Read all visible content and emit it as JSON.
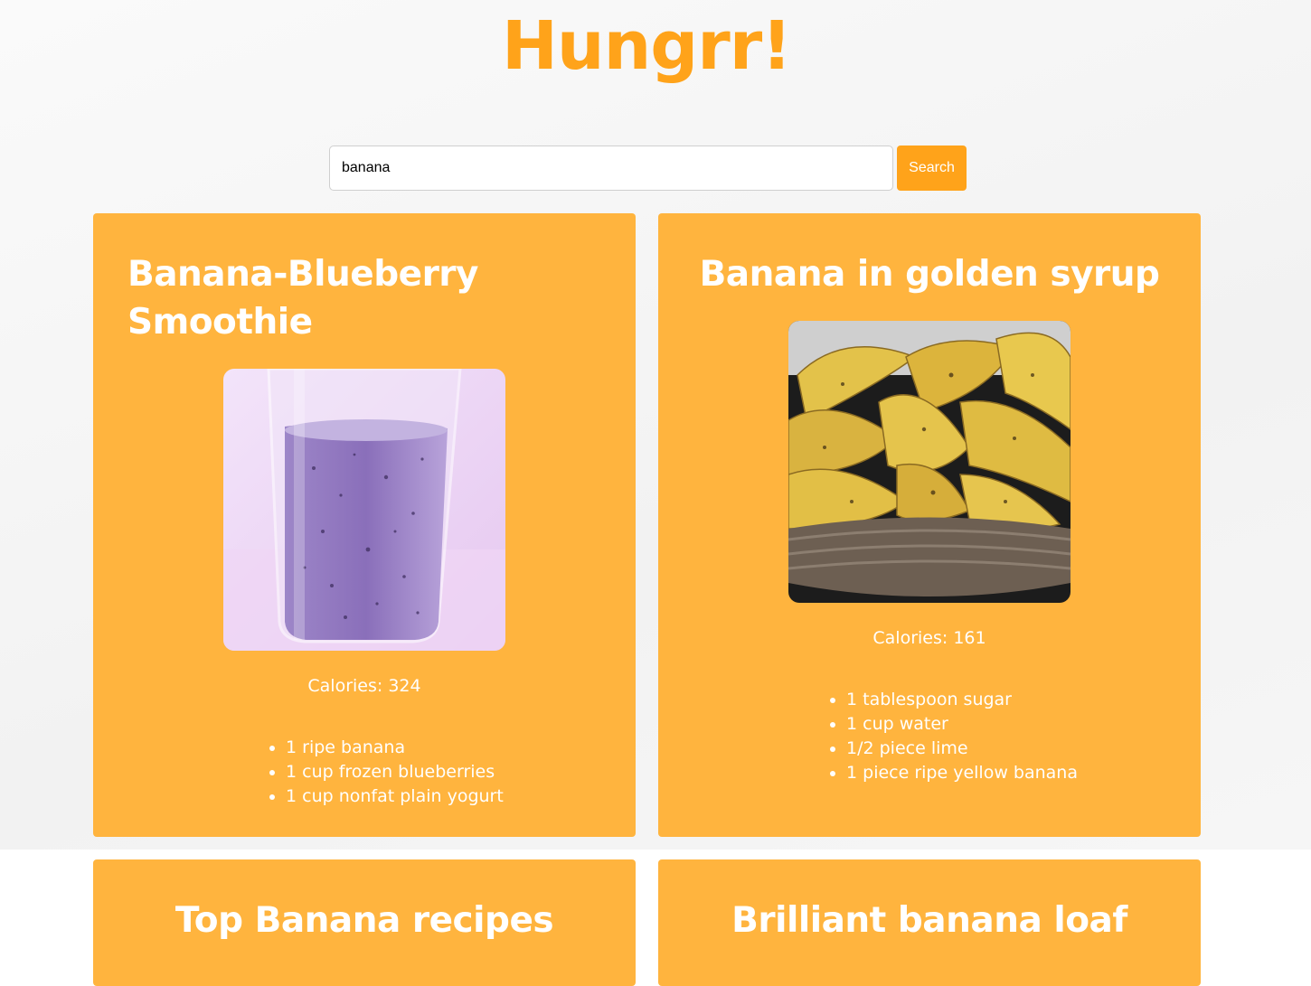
{
  "app": {
    "title": "Hungrr!"
  },
  "search": {
    "value": "banana",
    "button_label": "Search"
  },
  "colors": {
    "accent": "#ffa31a",
    "card": "#ffb43e",
    "text_on_card": "#ffffff"
  },
  "recipes": [
    {
      "title": "Banana-Blueberry Smoothie",
      "calories": "Calories: 324",
      "ingredients": [
        "1 ripe banana",
        "1 cup frozen blueberries",
        "1 cup nonfat plain yogurt"
      ]
    },
    {
      "title": "Banana in golden syrup",
      "calories": "Calories: 161",
      "ingredients": [
        "1 tablespoon sugar",
        "1 cup water",
        "1/2 piece lime",
        "1 piece ripe yellow banana"
      ]
    },
    {
      "title": "Top Banana recipes"
    },
    {
      "title": "Brilliant banana loaf"
    }
  ]
}
